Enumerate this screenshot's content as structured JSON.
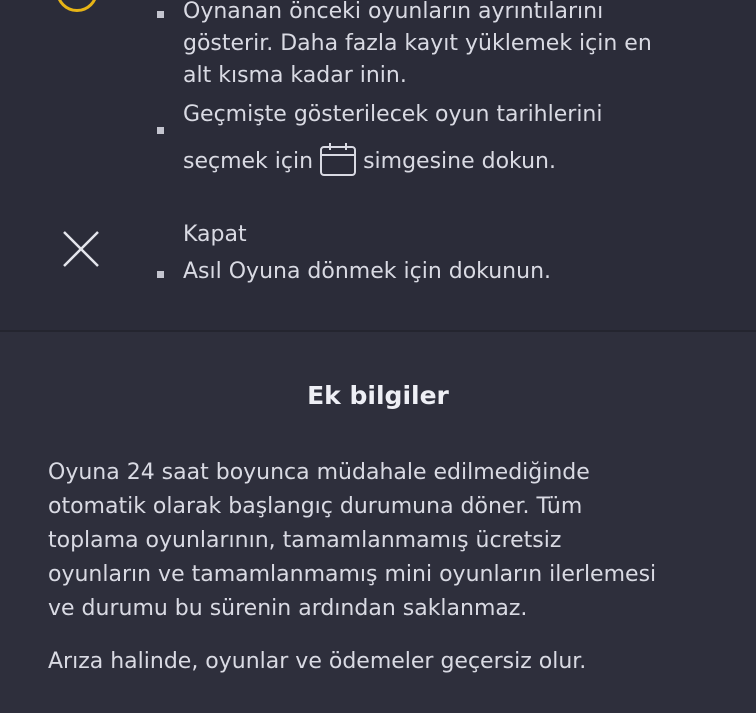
{
  "history": {
    "desc_lines": [
      "Oynanan önceki oyunların ayrıntılarını",
      "gösterir. Daha fazla kayıt yüklemek için en",
      "alt kısma kadar inin."
    ],
    "date_pick_line1": "Geçmişte gösterilecek oyun tarihlerini",
    "date_pick_before_icon": "seçmek için",
    "date_pick_after_icon": "simgesine dokun.",
    "accent_color": "#e7b416"
  },
  "close": {
    "label": "Kapat",
    "desc": "Asıl Oyuna dönmek için dokunun."
  },
  "additional_info": {
    "title": "Ek bilgiler",
    "paragraph1_lines": [
      "Oyuna 24 saat boyunca müdahale edilmediğinde",
      "otomatik olarak başlangıç durumuna döner. Tüm",
      "toplama oyunlarının, tamamlanmamış ücretsiz",
      "oyunların ve tamamlanmamış mini oyunların ilerlemesi",
      "ve durumu bu sürenin ardından saklanmaz."
    ],
    "paragraph2": "Arıza halinde, oyunlar ve ödemeler geçersiz olur."
  }
}
